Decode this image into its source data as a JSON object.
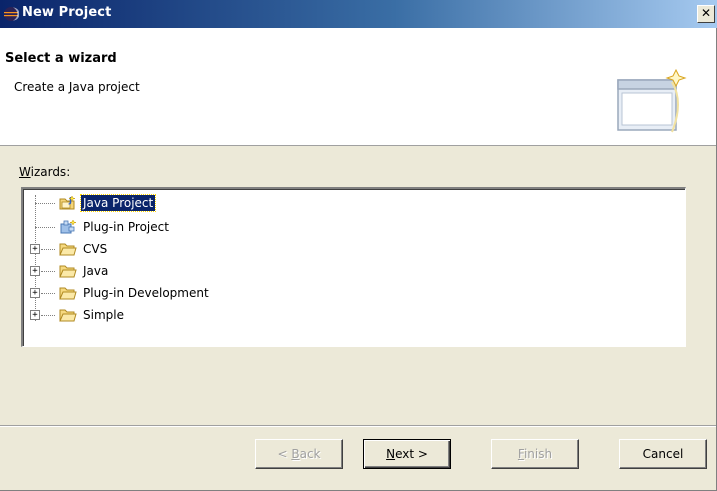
{
  "window": {
    "title": "New Project",
    "close_glyph": "✕",
    "app_icon": "eclipse-icon"
  },
  "banner": {
    "heading": "Select a wizard",
    "description": "Create a Java project",
    "image_icon": "new-wizard-window-icon"
  },
  "wizards_label": {
    "mnemonic": "W",
    "rest": "izards:"
  },
  "tree": {
    "items": [
      {
        "label": "Java Project",
        "icon": "java-project-icon",
        "selected": true,
        "expandable": false
      },
      {
        "label": "Plug-in Project",
        "icon": "plugin-project-icon",
        "selected": false,
        "expandable": false
      },
      {
        "label": "CVS",
        "icon": "folder-icon",
        "selected": false,
        "expandable": true
      },
      {
        "label": "Java",
        "icon": "folder-icon",
        "selected": false,
        "expandable": true
      },
      {
        "label": "Plug-in Development",
        "icon": "folder-icon",
        "selected": false,
        "expandable": true
      },
      {
        "label": "Simple",
        "icon": "folder-icon",
        "selected": false,
        "expandable": true
      }
    ],
    "expander_glyph": "+"
  },
  "buttons": {
    "back": {
      "prefix": "< ",
      "mnemonic": "B",
      "rest": "ack",
      "enabled": false
    },
    "next": {
      "mnemonic": "N",
      "rest": "ext >",
      "enabled": true
    },
    "finish": {
      "mnemonic": "F",
      "rest": "inish",
      "enabled": false
    },
    "cancel": {
      "label": "Cancel",
      "enabled": true
    }
  },
  "colors": {
    "titlebar_start": "#0a246a",
    "selection": "#0a246a",
    "dialog_bg": "#ece9d8"
  }
}
